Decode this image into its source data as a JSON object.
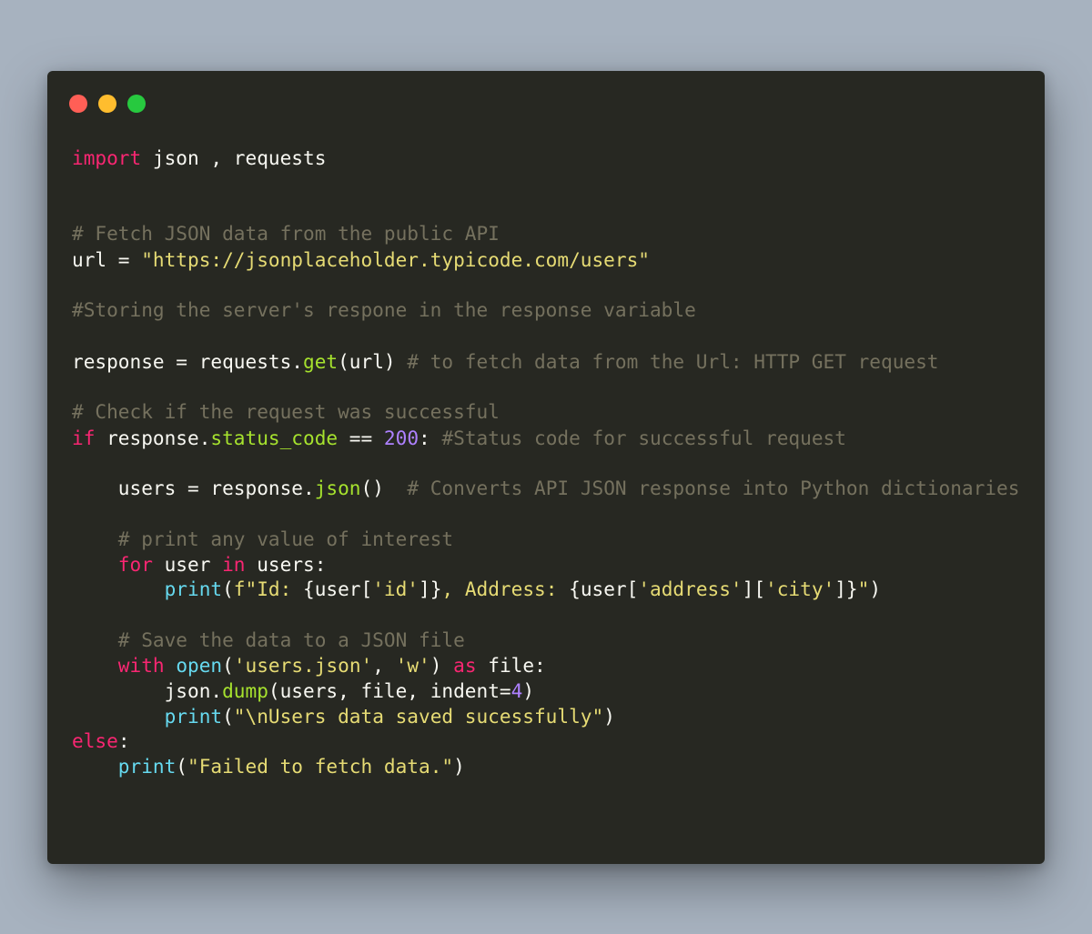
{
  "window": {
    "controls": [
      {
        "name": "close",
        "color": "#ff5f56"
      },
      {
        "name": "minimize",
        "color": "#ffbd2e"
      },
      {
        "name": "maximize",
        "color": "#27c93f"
      }
    ]
  },
  "theme": {
    "background": "#a7b2bf",
    "editor_background": "#272822",
    "keyword": "#f92672",
    "identifier": "#f8f8f2",
    "string": "#e6db74",
    "comment": "#75715e",
    "builtin": "#66d9ef",
    "method": "#a6e22e",
    "number": "#ae81ff"
  },
  "code": {
    "language": "python",
    "lines": [
      {
        "tokens": [
          {
            "t": "kw",
            "text": "import"
          },
          {
            "t": "id",
            "text": " json , requests"
          }
        ]
      },
      {
        "tokens": [
          {
            "t": "com",
            "text": "# Fetch JSON data from the public API"
          }
        ]
      },
      {
        "tokens": [
          {
            "t": "id",
            "text": "url = "
          },
          {
            "t": "str",
            "text": "\"https://jsonplaceholder.typicode.com/users\""
          }
        ]
      },
      {
        "tokens": [
          {
            "t": "com",
            "text": "#Storing the server's respone in the response variable"
          }
        ]
      },
      {
        "tokens": [
          {
            "t": "id",
            "text": "response = requests."
          },
          {
            "t": "meth",
            "text": "get"
          },
          {
            "t": "id",
            "text": "(url) "
          },
          {
            "t": "com",
            "text": "# to fetch data from the Url: HTTP GET request"
          }
        ]
      },
      {
        "tokens": [
          {
            "t": "com",
            "text": "# Check if the request was successful"
          }
        ]
      },
      {
        "tokens": [
          {
            "t": "kw",
            "text": "if"
          },
          {
            "t": "id",
            "text": " response."
          },
          {
            "t": "meth",
            "text": "status_code"
          },
          {
            "t": "id",
            "text": " == "
          },
          {
            "t": "num",
            "text": "200"
          },
          {
            "t": "id",
            "text": ": "
          },
          {
            "t": "com",
            "text": "#Status code for successful request"
          }
        ]
      },
      {
        "tokens": [
          {
            "t": "id",
            "text": "    users = response."
          },
          {
            "t": "meth",
            "text": "json"
          },
          {
            "t": "id",
            "text": "()  "
          },
          {
            "t": "com",
            "text": "# Converts API JSON response into Python dictionaries"
          }
        ]
      },
      {
        "tokens": [
          {
            "t": "com",
            "text": "    # print any value of interest"
          }
        ]
      },
      {
        "tokens": [
          {
            "t": "kw",
            "text": "    for"
          },
          {
            "t": "id",
            "text": " user "
          },
          {
            "t": "kw",
            "text": "in"
          },
          {
            "t": "id",
            "text": " users:"
          }
        ]
      },
      {
        "tokens": [
          {
            "t": "fn",
            "text": "        print"
          },
          {
            "t": "id",
            "text": "("
          },
          {
            "t": "str",
            "text": "f\"Id: "
          },
          {
            "t": "id",
            "text": "{user["
          },
          {
            "t": "str",
            "text": "'id'"
          },
          {
            "t": "id",
            "text": "]}"
          },
          {
            "t": "str",
            "text": ", Address: "
          },
          {
            "t": "id",
            "text": "{user["
          },
          {
            "t": "str",
            "text": "'address'"
          },
          {
            "t": "id",
            "text": "]["
          },
          {
            "t": "str",
            "text": "'city'"
          },
          {
            "t": "id",
            "text": "]}"
          },
          {
            "t": "str",
            "text": "\""
          },
          {
            "t": "id",
            "text": ")"
          }
        ]
      },
      {
        "tokens": [
          {
            "t": "com",
            "text": "    # Save the data to a JSON file"
          }
        ]
      },
      {
        "tokens": [
          {
            "t": "kw",
            "text": "    with"
          },
          {
            "t": "id",
            "text": " "
          },
          {
            "t": "fn",
            "text": "open"
          },
          {
            "t": "id",
            "text": "("
          },
          {
            "t": "str",
            "text": "'users.json'"
          },
          {
            "t": "id",
            "text": ", "
          },
          {
            "t": "str",
            "text": "'w'"
          },
          {
            "t": "id",
            "text": ") "
          },
          {
            "t": "kw",
            "text": "as"
          },
          {
            "t": "id",
            "text": " file:"
          }
        ]
      },
      {
        "tokens": [
          {
            "t": "id",
            "text": "        json."
          },
          {
            "t": "meth",
            "text": "dump"
          },
          {
            "t": "id",
            "text": "(users, file, indent="
          },
          {
            "t": "num",
            "text": "4"
          },
          {
            "t": "id",
            "text": ")"
          }
        ]
      },
      {
        "tokens": [
          {
            "t": "fn",
            "text": "        print"
          },
          {
            "t": "id",
            "text": "("
          },
          {
            "t": "str",
            "text": "\"\\nUsers data saved sucessfully\""
          },
          {
            "t": "id",
            "text": ")"
          }
        ]
      },
      {
        "tokens": [
          {
            "t": "kw",
            "text": "else"
          },
          {
            "t": "id",
            "text": ":"
          }
        ]
      },
      {
        "tokens": [
          {
            "t": "fn",
            "text": "    print"
          },
          {
            "t": "id",
            "text": "("
          },
          {
            "t": "str",
            "text": "\"Failed to fetch data.\""
          },
          {
            "t": "id",
            "text": ")"
          }
        ]
      }
    ]
  }
}
